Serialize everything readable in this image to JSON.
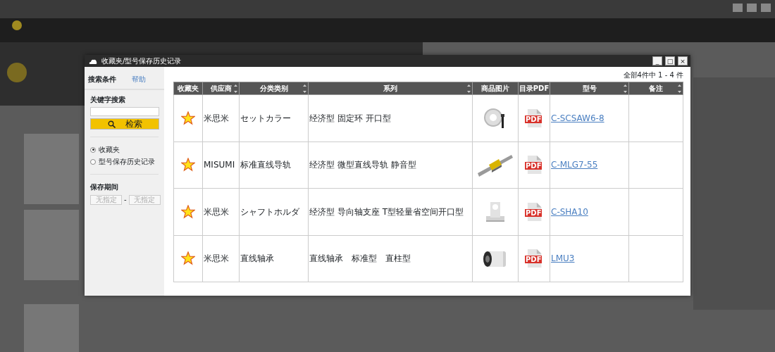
{
  "dialog": {
    "title": "收藏夹/型号保存历史记录",
    "window_buttons": [
      "_",
      "□",
      "×"
    ]
  },
  "sidebar": {
    "heading": "搜索条件",
    "help_link": "帮助",
    "keyword_label": "关键字搜索",
    "search_button": "检索",
    "modes": [
      {
        "label": "收藏夹",
        "selected": true
      },
      {
        "label": "型号保存历史记录",
        "selected": false
      }
    ],
    "period_label": "保存期间",
    "date_from": {
      "placeholder": "无指定"
    },
    "date_separator": "-",
    "date_to": {
      "placeholder": "无指定"
    }
  },
  "result_count": "全部4件中 1 - 4 件",
  "table": {
    "columns": [
      {
        "label": "收藏夹",
        "sortable": false
      },
      {
        "label": "供应商",
        "sortable": true
      },
      {
        "label": "分类类别",
        "sortable": true
      },
      {
        "label": "系列",
        "sortable": true
      },
      {
        "label": "商品图片",
        "sortable": false
      },
      {
        "label": "目录PDF",
        "sortable": false
      },
      {
        "label": "型号",
        "sortable": true
      },
      {
        "label": "备注",
        "sortable": true
      }
    ],
    "rows": [
      {
        "favorite": true,
        "supplier": "米思米",
        "category": "セットカラー",
        "series": "经济型 固定环 开口型",
        "pdf": "PDF",
        "model": "C-SCSAW6-8"
      },
      {
        "favorite": true,
        "supplier": "MISUMI",
        "category": "标准直线导轨",
        "series": "经济型 微型直线导轨 静音型",
        "pdf": "PDF",
        "model": "C-MLG7-55"
      },
      {
        "favorite": true,
        "supplier": "米思米",
        "category": "シャフトホルダ",
        "series": "经济型 导向轴支座 T型轻量省空间开口型",
        "pdf": "PDF",
        "model": "C-SHA10"
      },
      {
        "favorite": true,
        "supplier": "米思米",
        "category": "直线轴承",
        "series": "直线轴承　标准型　直柱型",
        "pdf": "PDF",
        "model": "LMU3"
      }
    ]
  }
}
